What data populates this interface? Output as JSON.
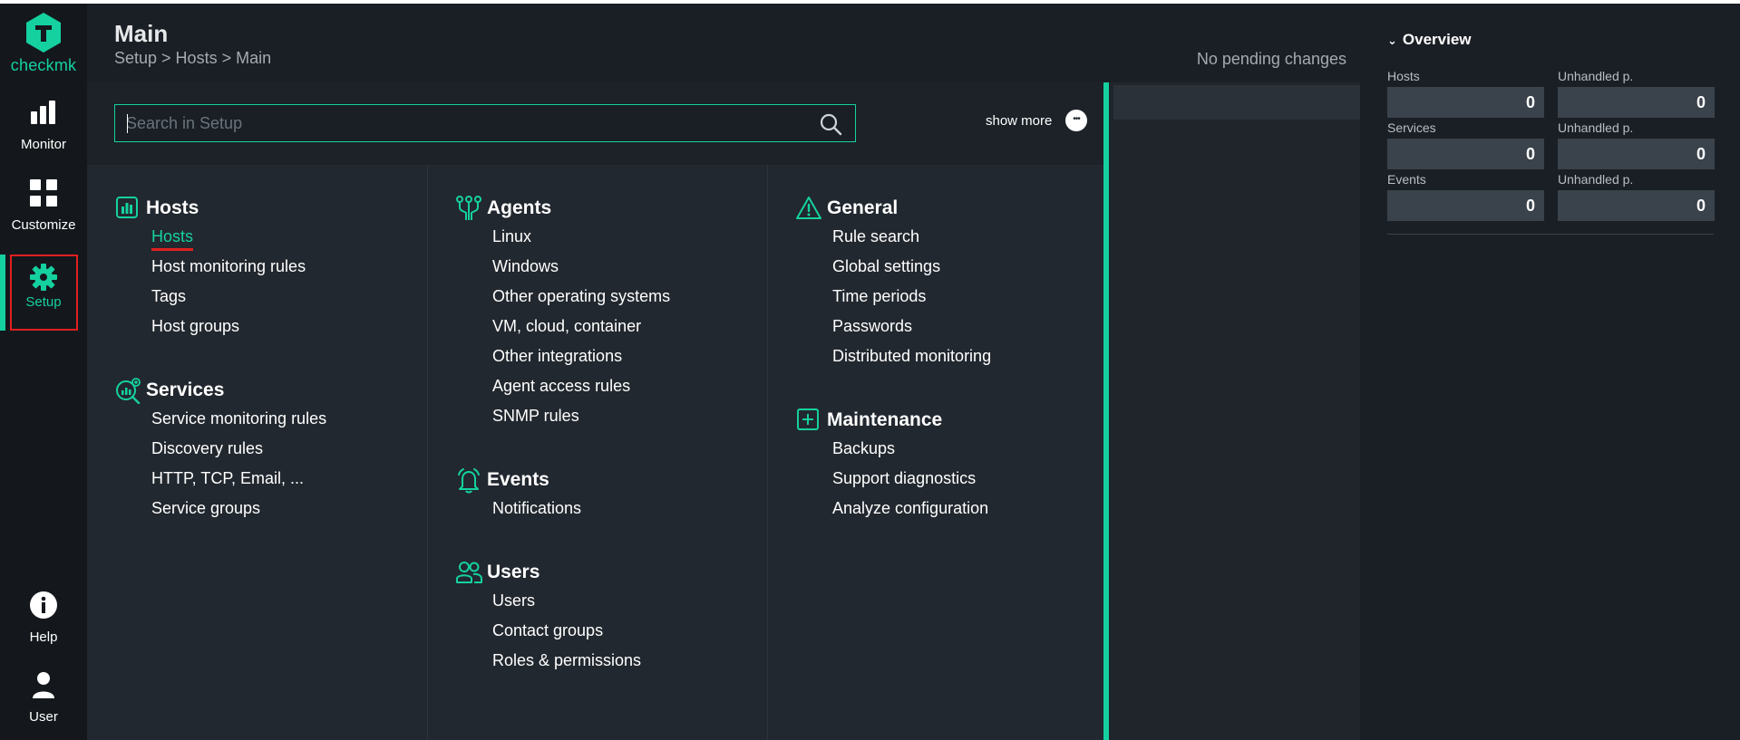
{
  "brand": {
    "name_check": "check",
    "name_mk": "mk",
    "accent": "#15d1a0"
  },
  "nav": {
    "monitor": "Monitor",
    "customize": "Customize",
    "setup": "Setup",
    "help": "Help",
    "user": "User"
  },
  "header": {
    "title": "Main",
    "breadcrumb": "Setup > Hosts > Main",
    "pending": "No pending changes"
  },
  "search": {
    "placeholder": "Search in Setup"
  },
  "show_more": "show more",
  "menu": {
    "hosts": {
      "title": "Hosts",
      "items": [
        "Hosts",
        "Host monitoring rules",
        "Tags",
        "Host groups"
      ]
    },
    "services": {
      "title": "Services",
      "items": [
        "Service monitoring rules",
        "Discovery rules",
        "HTTP, TCP, Email, ...",
        "Service groups"
      ]
    },
    "agents": {
      "title": "Agents",
      "items": [
        "Linux",
        "Windows",
        "Other operating systems",
        "VM, cloud, container",
        "Other integrations",
        "Agent access rules",
        "SNMP rules"
      ]
    },
    "events": {
      "title": "Events",
      "items": [
        "Notifications"
      ]
    },
    "users": {
      "title": "Users",
      "items": [
        "Users",
        "Contact groups",
        "Roles & permissions"
      ]
    },
    "general": {
      "title": "General",
      "items": [
        "Rule search",
        "Global settings",
        "Time periods",
        "Passwords",
        "Distributed monitoring"
      ]
    },
    "maintenance": {
      "title": "Maintenance",
      "items": [
        "Backups",
        "Support diagnostics",
        "Analyze configuration"
      ]
    }
  },
  "overview": {
    "title": "Overview",
    "rows": [
      {
        "label": "Hosts",
        "value": "0",
        "unhandled_label": "Unhandled p.",
        "unhandled_value": "0"
      },
      {
        "label": "Services",
        "value": "0",
        "unhandled_label": "Unhandled p.",
        "unhandled_value": "0"
      },
      {
        "label": "Events",
        "value": "0",
        "unhandled_label": "Unhandled p.",
        "unhandled_value": "0"
      }
    ]
  }
}
